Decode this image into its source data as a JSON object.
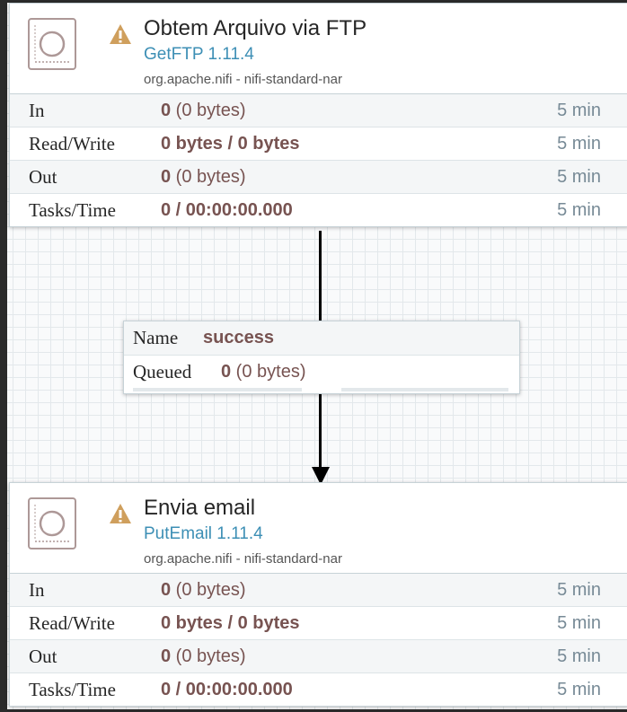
{
  "processors": [
    {
      "name": "Obtem Arquivo via FTP",
      "type": "GetFTP 1.11.4",
      "bundle": "org.apache.nifi - nifi-standard-nar",
      "stats": {
        "in": {
          "label": "In",
          "count": "0",
          "detail": " (0 bytes)",
          "window": "5 min"
        },
        "read_write": {
          "label": "Read/Write",
          "value": "0 bytes / 0 bytes",
          "window": "5 min"
        },
        "out": {
          "label": "Out",
          "count": "0",
          "detail": " (0 bytes)",
          "window": "5 min"
        },
        "tasks_time": {
          "label": "Tasks/Time",
          "value": "0 / 00:00:00.000",
          "window": "5 min"
        }
      }
    },
    {
      "name": "Envia email",
      "type": "PutEmail 1.11.4",
      "bundle": "org.apache.nifi - nifi-standard-nar",
      "stats": {
        "in": {
          "label": "In",
          "count": "0",
          "detail": " (0 bytes)",
          "window": "5 min"
        },
        "read_write": {
          "label": "Read/Write",
          "value": "0 bytes / 0 bytes",
          "window": "5 min"
        },
        "out": {
          "label": "Out",
          "count": "0",
          "detail": " (0 bytes)",
          "window": "5 min"
        },
        "tasks_time": {
          "label": "Tasks/Time",
          "value": "0 / 00:00:00.000",
          "window": "5 min"
        }
      }
    }
  ],
  "connection": {
    "name_label": "Name",
    "name_value": "success",
    "queued_label": "Queued",
    "queued_count": "0",
    "queued_detail": " (0 bytes)"
  },
  "icons": {
    "processor": "processor-icon",
    "warning": "warning-icon",
    "arrow": "arrow-down-icon"
  },
  "colors": {
    "accent_type": "#3d8fb5",
    "value_text": "#775351",
    "warning": "#cf9f5d",
    "window_text": "#778a96",
    "icon_border": "#ad9897"
  }
}
